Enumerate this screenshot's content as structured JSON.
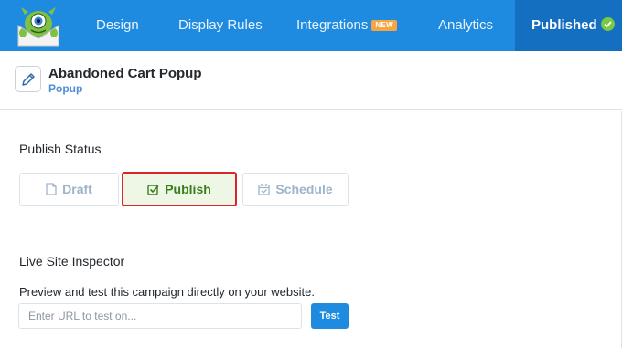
{
  "nav": {
    "items": [
      {
        "label": "Design"
      },
      {
        "label": "Display Rules"
      },
      {
        "label": "Integrations",
        "badge": "NEW"
      },
      {
        "label": "Analytics"
      },
      {
        "label": "Published",
        "icon": "check-circle-icon"
      }
    ],
    "active": "Published",
    "colors": {
      "bar": "#1f8be0",
      "active": "#156fc1",
      "badge": "#f7a540",
      "check": "#7ac943"
    }
  },
  "campaign": {
    "name": "Abandoned Cart Popup",
    "type": "Popup",
    "icon": "pencil-icon"
  },
  "publish_status": {
    "title": "Publish Status",
    "options": [
      {
        "label": "Draft",
        "icon": "document-icon"
      },
      {
        "label": "Publish",
        "icon": "checkbox-icon"
      },
      {
        "label": "Schedule",
        "icon": "calendar-check-icon"
      }
    ],
    "selected": "Publish"
  },
  "live_inspector": {
    "title": "Live Site Inspector",
    "description": "Preview and test this campaign directly on your website.",
    "url_placeholder": "Enter URL to test on...",
    "url_value": "",
    "test_label": "Test"
  }
}
